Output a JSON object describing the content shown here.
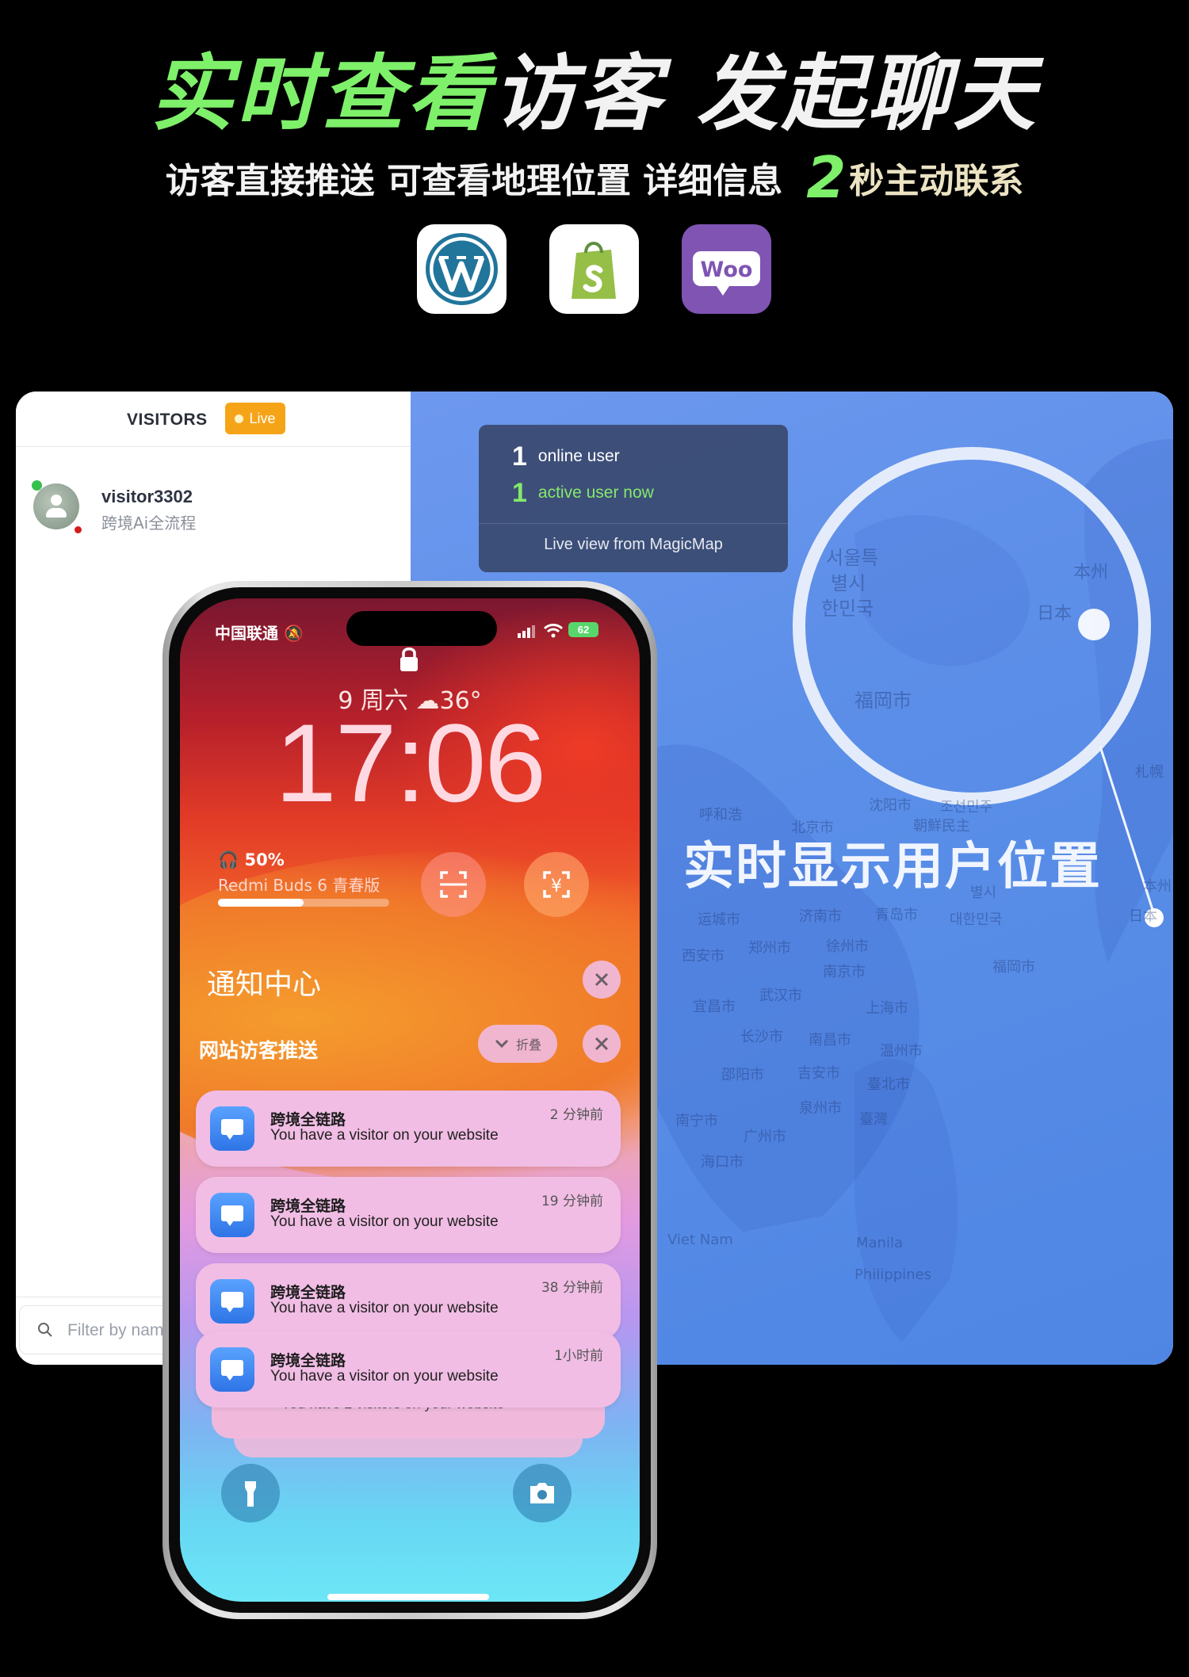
{
  "header": {
    "headline_green": "实时查看",
    "headline_white": "访客 发起聊天",
    "subline": "访客直接推送 可查看地理位置 详细信息",
    "subline_num": "2",
    "subline_tail": "秒主动联系",
    "logos": [
      "wordpress-logo",
      "shopify-logo",
      "woocommerce-logo"
    ],
    "woo_text": "Woo"
  },
  "dashboard": {
    "sidebar": {
      "title": "VISITORS",
      "live_label": "Live",
      "visitor": {
        "name": "visitor3302",
        "subtitle": "跨境Ai全流程"
      },
      "filter_placeholder": "Filter by name"
    },
    "map": {
      "stats": {
        "online_num": "1",
        "online_label": "online user",
        "active_num": "1",
        "active_label": "active user now",
        "footer": "Live view from MagicMap"
      },
      "caption": "实时显示用户位置",
      "cities": [
        "서울특",
        "별시",
        "한민국",
        "福岡市",
        "本州",
        "日本",
        "呼和浩",
        "北京市",
        "沈阳市",
        "朝鮮民主",
        "조선민주",
        "札幌",
        "运城市",
        "济南市",
        "青岛市",
        "대한민국",
        "西安市",
        "郑州市",
        "徐州市",
        "南京市",
        "武汉市",
        "上海市",
        "宜昌市",
        "长沙市",
        "南昌市",
        "温州市",
        "邵阳市",
        "吉安市",
        "臺北市",
        "泉州市",
        "南宁市",
        "广州市",
        "臺灣",
        "海口市",
        "Viet Nam",
        "Manila",
        "Philippines",
        "本州",
        "日本",
        "별시",
        "福岡市"
      ]
    },
    "colors": {
      "live": "#f6a417",
      "accent_green": "#7ef06a",
      "map_blue": "#5b8fe8"
    }
  },
  "phone": {
    "carrier": "中国联通",
    "battery": "62",
    "date_line": "9 周六",
    "weather": "36°",
    "time": "17:06",
    "buds": {
      "percent": "50%",
      "name": "Redmi Buds 6 青春版",
      "level": 0.5
    },
    "notification_center": "通知中心",
    "group_title": "网站访客推送",
    "fold_label": "折叠",
    "notifications": [
      {
        "app": "跨境全链路",
        "message": "You have a visitor on your website",
        "time": "2 分钟前"
      },
      {
        "app": "跨境全链路",
        "message": "You have a visitor on your website",
        "time": "19 分钟前"
      },
      {
        "app": "跨境全链路",
        "message": "You have a visitor on your website",
        "time": "38 分钟前"
      },
      {
        "app": "跨境全链路",
        "message": "You have a visitor on your website",
        "time": "1小时前"
      }
    ],
    "stacked_message": "You have 2 visitors on your website"
  }
}
